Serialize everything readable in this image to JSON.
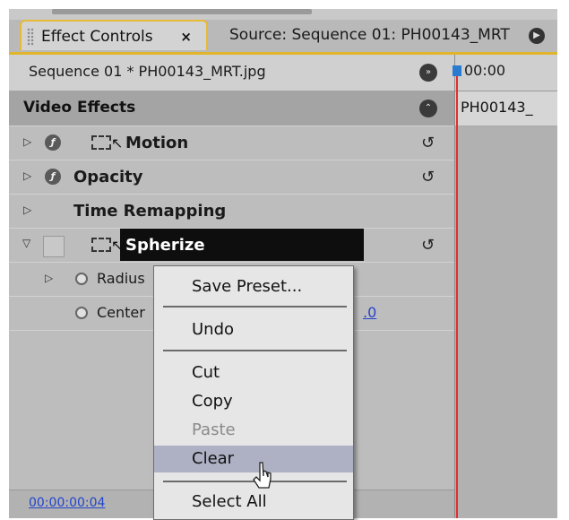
{
  "tabs": {
    "effect_controls": "Effect Controls",
    "close_symbol": "×",
    "source": "Source: Sequence 01: PH00143_MRT"
  },
  "clip_header": {
    "name": "Sequence 01 * PH00143_MRT.jpg"
  },
  "video_effects": {
    "title": "Video Effects"
  },
  "effects": [
    {
      "label": "Motion"
    },
    {
      "label": "Opacity"
    },
    {
      "label": "Time Remapping"
    },
    {
      "label": "Spherize"
    }
  ],
  "properties": {
    "radius": "Radius",
    "center": "Center",
    "center_value_partial": ".0"
  },
  "timeline": {
    "time": "00:00",
    "clip": "PH00143_"
  },
  "footer": {
    "timecode": "00:00:00:04"
  },
  "context_menu": {
    "items": [
      "Save Preset...",
      "Undo",
      "Cut",
      "Copy",
      "Paste",
      "Clear",
      "Select All"
    ],
    "disabled": [
      "Paste"
    ],
    "highlighted": "Clear"
  },
  "colors": {
    "accent_border": "#e1b52a",
    "playhead": "#e03030",
    "link_value": "#2244cc",
    "menu_hover": "#aeb0c4"
  },
  "icons": [
    "grip-icon",
    "close-icon",
    "panel-menu-icon",
    "expand-icon",
    "collapse-icon",
    "triangle-icon",
    "fx-toggle-icon",
    "motion-effect-icon",
    "reset-icon",
    "stopwatch-icon",
    "playhead-icon",
    "mouse-pointer-icon"
  ]
}
